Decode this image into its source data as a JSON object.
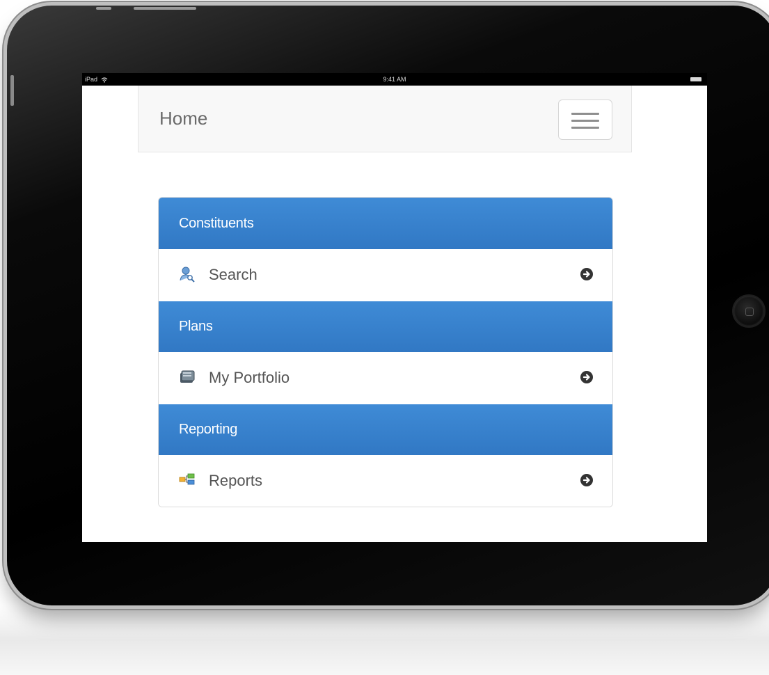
{
  "status_bar": {
    "device": "iPad",
    "time": "9:41 AM"
  },
  "header": {
    "title": "Home",
    "menu_icon": "hamburger-menu-icon"
  },
  "sections": [
    {
      "title": "Constituents",
      "item": {
        "label": "Search",
        "icon": "person-search-icon"
      }
    },
    {
      "title": "Plans",
      "item": {
        "label": "My Portfolio",
        "icon": "portfolio-icon"
      }
    },
    {
      "title": "Reporting",
      "item": {
        "label": "Reports",
        "icon": "reports-icon"
      }
    }
  ],
  "colors": {
    "section_header": "#3a84d0",
    "header_text": "#ffffff",
    "item_text": "#555555",
    "arrow": "#333333"
  }
}
